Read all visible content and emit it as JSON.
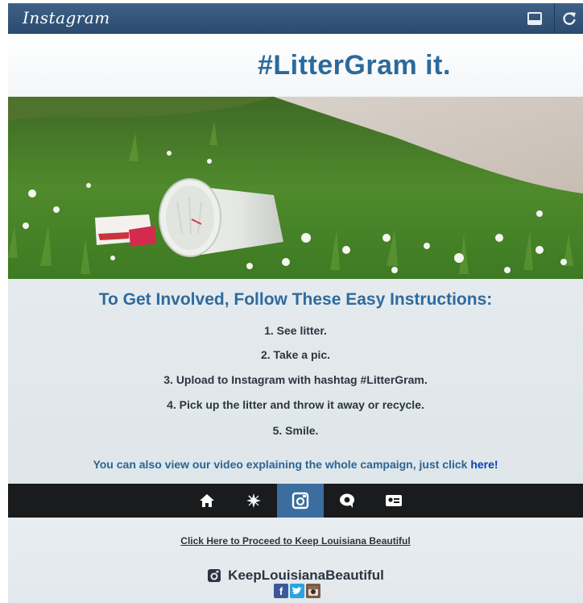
{
  "app": {
    "title": "Instagram"
  },
  "topbar": {
    "inbox_icon": "inbox-icon",
    "refresh_icon": "refresh-icon"
  },
  "banner": {
    "headline": "#LitterGram it."
  },
  "instructions": {
    "heading": "To Get Involved, Follow These Easy Instructions:",
    "steps": [
      "1. See litter.",
      "2. Take a pic.",
      "3. Upload to Instagram with hashtag #LitterGram.",
      "4. Pick up the litter and throw it away or recycle.",
      "5. Smile."
    ],
    "video_text": "You can also view our video explaining the whole campaign, just click",
    "video_link": "here!"
  },
  "nav": {
    "items": [
      "home-icon",
      "explore-icon",
      "camera-icon",
      "news-icon",
      "profile-icon"
    ],
    "active_index": 2
  },
  "footer": {
    "proceed_link": "Click Here to Proceed to Keep Louisiana Beautiful",
    "handle": "KeepLouisianaBeautiful",
    "social_icons": [
      "facebook-icon",
      "twitter-icon",
      "instagram-icon"
    ]
  },
  "colors": {
    "topbar": "#2f5279",
    "headline": "#2b6a9c",
    "heading": "#2e6b9e",
    "nav_bg": "#191b1d",
    "nav_active": "#3b6d9e",
    "link": "#0b3fb8"
  }
}
